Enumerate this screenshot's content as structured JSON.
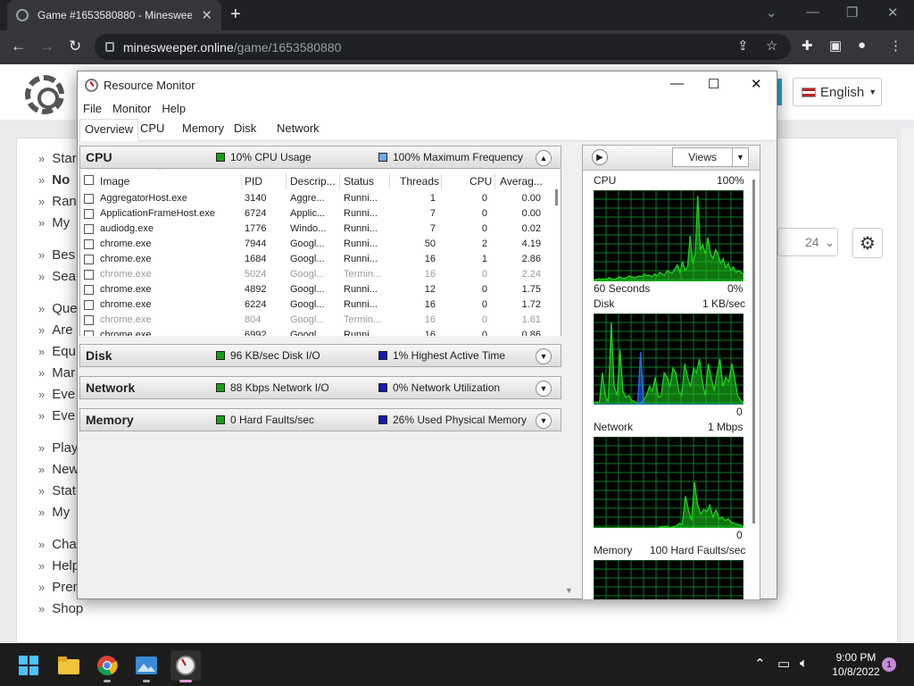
{
  "browser": {
    "tab_title": "Game #1653580880 - Minesweep",
    "url_host": "minesweeper.online",
    "url_path": "/game/1653580880"
  },
  "site": {
    "language": "English",
    "level_value": "24",
    "side_links": [
      "Star",
      "No",
      "Ran",
      "My",
      "Bes",
      "Sea",
      "Que",
      "Are",
      "Equ",
      "Mar",
      "Eve",
      "Eve",
      "Play",
      "New",
      "Stat",
      "My",
      "Cha",
      "Help",
      "Premium account",
      "Shop"
    ]
  },
  "rm": {
    "title": "Resource Monitor",
    "menu": [
      "File",
      "Monitor",
      "Help"
    ],
    "tabs": [
      "Overview",
      "CPU",
      "Memory",
      "Disk",
      "Network"
    ],
    "cpu": {
      "name": "CPU",
      "legend1": "10% CPU Usage",
      "legend2": "100% Maximum Frequency",
      "columns": [
        "Image",
        "PID",
        "Descrip...",
        "Status",
        "Threads",
        "CPU",
        "Averag..."
      ],
      "rows": [
        {
          "image": "AggregatorHost.exe",
          "pid": "3140",
          "desc": "Aggre...",
          "status": "Runni...",
          "threads": "1",
          "cpu": "0",
          "avg": "0.00",
          "dim": false
        },
        {
          "image": "ApplicationFrameHost.exe",
          "pid": "6724",
          "desc": "Applic...",
          "status": "Runni...",
          "threads": "7",
          "cpu": "0",
          "avg": "0.00",
          "dim": false
        },
        {
          "image": "audiodg.exe",
          "pid": "1776",
          "desc": "Windo...",
          "status": "Runni...",
          "threads": "7",
          "cpu": "0",
          "avg": "0.02",
          "dim": false
        },
        {
          "image": "chrome.exe",
          "pid": "7944",
          "desc": "Googl...",
          "status": "Runni...",
          "threads": "50",
          "cpu": "2",
          "avg": "4.19",
          "dim": false
        },
        {
          "image": "chrome.exe",
          "pid": "1684",
          "desc": "Googl...",
          "status": "Runni...",
          "threads": "16",
          "cpu": "1",
          "avg": "2.86",
          "dim": false
        },
        {
          "image": "chrome.exe",
          "pid": "5024",
          "desc": "Googl...",
          "status": "Termin...",
          "threads": "16",
          "cpu": "0",
          "avg": "2.24",
          "dim": true
        },
        {
          "image": "chrome.exe",
          "pid": "4892",
          "desc": "Googl...",
          "status": "Runni...",
          "threads": "12",
          "cpu": "0",
          "avg": "1.75",
          "dim": false
        },
        {
          "image": "chrome.exe",
          "pid": "6224",
          "desc": "Googl...",
          "status": "Runni...",
          "threads": "16",
          "cpu": "0",
          "avg": "1.72",
          "dim": false
        },
        {
          "image": "chrome.exe",
          "pid": "804",
          "desc": "Googl...",
          "status": "Termin...",
          "threads": "16",
          "cpu": "0",
          "avg": "1.61",
          "dim": true
        },
        {
          "image": "chrome.exe",
          "pid": "6992",
          "desc": "Googl...",
          "status": "Runni...",
          "threads": "16",
          "cpu": "0",
          "avg": "0.86",
          "dim": false
        }
      ]
    },
    "disk": {
      "name": "Disk",
      "legend1": "96 KB/sec Disk I/O",
      "legend2": "1% Highest Active Time"
    },
    "network": {
      "name": "Network",
      "legend1": "88 Kbps Network I/O",
      "legend2": "0% Network Utilization"
    },
    "memory": {
      "name": "Memory",
      "legend1": "0 Hard Faults/sec",
      "legend2": "26% Used Physical Memory"
    },
    "views_label": "Views",
    "graphs": {
      "cpu": {
        "label": "CPU",
        "max": "100%",
        "bottom_left": "60 Seconds",
        "bottom_right": "0%"
      },
      "disk": {
        "label": "Disk",
        "max": "1 KB/sec",
        "bottom_right": "0"
      },
      "network": {
        "label": "Network",
        "max": "1 Mbps",
        "bottom_right": "0"
      },
      "memory": {
        "label": "Memory",
        "max": "100 Hard Faults/sec"
      }
    }
  },
  "taskbar": {
    "time": "9:00 PM",
    "date": "10/8/2022",
    "notifications": "1"
  },
  "colors": {
    "graph_green": "#1ed41e",
    "graph_blue": "#2a6bff",
    "grid": "#0c7a2a"
  }
}
